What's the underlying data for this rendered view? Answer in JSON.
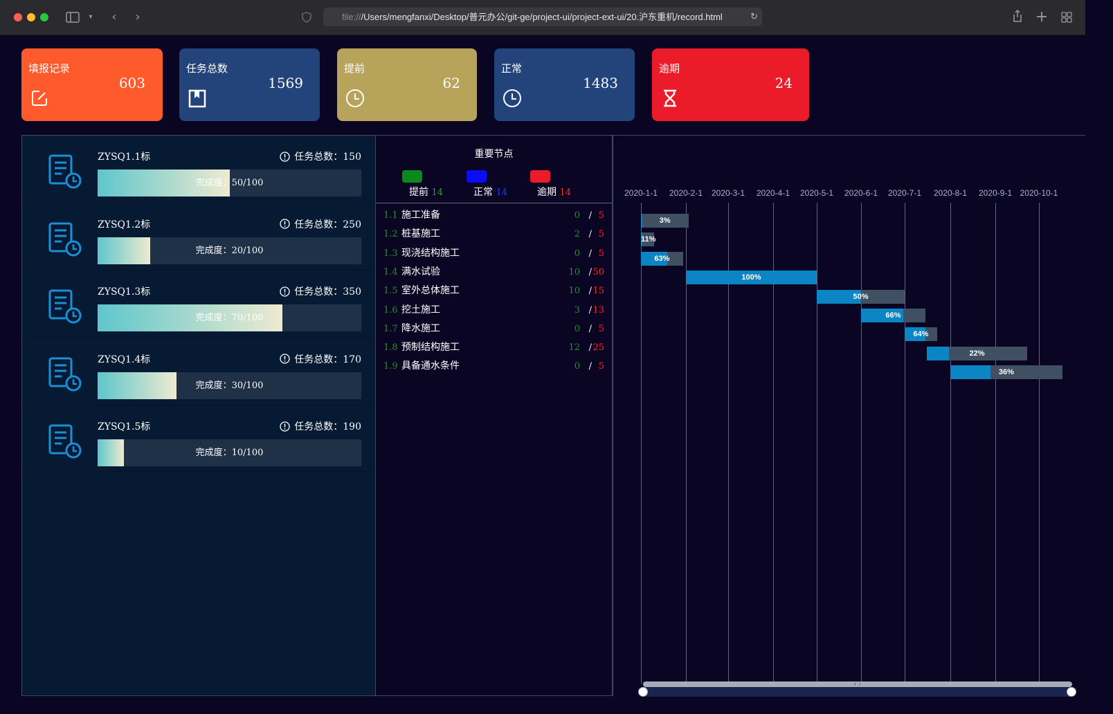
{
  "browser": {
    "url_prefix": "file://",
    "url_path": "/Users/mengfanxi/Desktop/普元办公/git-ge/project-ui/project-ext-ui/20.沪东重机/record.html"
  },
  "stats": [
    {
      "title": "填报记录",
      "value": "603",
      "color": "#ff5a2b",
      "icon": "edit-icon"
    },
    {
      "title": "任务总数",
      "value": "1569",
      "color": "#23447b",
      "icon": "bookmark-icon"
    },
    {
      "title": "提前",
      "value": "62",
      "color": "#b7a35a",
      "icon": "clock-icon"
    },
    {
      "title": "正常",
      "value": "1483",
      "color": "#23447b",
      "icon": "clock-icon"
    },
    {
      "title": "逾期",
      "value": "24",
      "color": "#ec1b2a",
      "icon": "hourglass-icon"
    }
  ],
  "sections": [
    {
      "name": "ZYSQ1.1标",
      "total_label": "任务总数：150",
      "progress_label": "完成度：50/100",
      "progress": 0.5
    },
    {
      "name": "ZYSQ1.2标",
      "total_label": "任务总数：250",
      "progress_label": "完成度：20/100",
      "progress": 0.2
    },
    {
      "name": "ZYSQ1.3标",
      "total_label": "任务总数：350",
      "progress_label": "完成度：70/100",
      "progress": 0.7
    },
    {
      "name": "ZYSQ1.4标",
      "total_label": "任务总数：170",
      "progress_label": "完成度：30/100",
      "progress": 0.3
    },
    {
      "name": "ZYSQ1.5标",
      "total_label": "任务总数：190",
      "progress_label": "完成度：10/100",
      "progress": 0.1
    }
  ],
  "nodes_panel": {
    "title": "重要节点",
    "legend": [
      {
        "label": "提前",
        "count": "14",
        "color": "#0b8a1b",
        "count_color": "#2aa52a"
      },
      {
        "label": "正常",
        "count": "14",
        "color": "#0b0bf5",
        "count_color": "#1a3cff"
      },
      {
        "label": "逾期",
        "count": "14",
        "color": "#ec1b2a",
        "count_color": "#ff2a2a"
      }
    ],
    "rows": [
      {
        "num": "1.1",
        "name": "施工准备",
        "ahead": "0",
        "over": "5"
      },
      {
        "num": "1.2",
        "name": "桩基施工",
        "ahead": "2",
        "over": "5"
      },
      {
        "num": "1.3",
        "name": "现浇结构施工",
        "ahead": "0",
        "over": "5"
      },
      {
        "num": "1.4",
        "name": "满水试验",
        "ahead": "10",
        "over": "50"
      },
      {
        "num": "1.5",
        "name": "室外总体施工",
        "ahead": "10",
        "over": "15"
      },
      {
        "num": "1.6",
        "name": "挖土施工",
        "ahead": "3",
        "over": "13"
      },
      {
        "num": "1.7",
        "name": "降水施工",
        "ahead": "0",
        "over": "5"
      },
      {
        "num": "1.8",
        "name": "预制结构施工",
        "ahead": "12",
        "over": "25"
      },
      {
        "num": "1.9",
        "name": "具备通水条件",
        "ahead": "0",
        "over": "5"
      }
    ],
    "slash": "/"
  },
  "chart_data": {
    "type": "gantt",
    "x_ticks": [
      "2020-1-1",
      "2020-2-1",
      "2020-3-1",
      "2020-4-1",
      "2020-5-1",
      "2020-6-1",
      "2020-7-1",
      "2020-8-1",
      "2020-9-1",
      "2020-10-1"
    ],
    "tasks": [
      {
        "label": "3%",
        "start": "2020-1-1",
        "end": "2020-2-3",
        "progress": 0.03
      },
      {
        "label": "11%",
        "start": "2020-1-1",
        "end": "2020-1-10",
        "progress": 0.11
      },
      {
        "label": "63%",
        "start": "2020-1-1",
        "end": "2020-1-30",
        "progress": 0.63
      },
      {
        "label": "100%",
        "start": "2020-2-1",
        "end": "2020-5-1",
        "progress": 1.0
      },
      {
        "label": "50%",
        "start": "2020-5-1",
        "end": "2020-7-1",
        "progress": 0.5
      },
      {
        "label": "66%",
        "start": "2020-6-1",
        "end": "2020-7-15",
        "progress": 0.66
      },
      {
        "label": "64%",
        "start": "2020-7-1",
        "end": "2020-7-23",
        "progress": 0.64
      },
      {
        "label": "22%",
        "start": "2020-7-16",
        "end": "2020-9-23",
        "progress": 0.22
      },
      {
        "label": "36%",
        "start": "2020-8-1",
        "end": "2020-10-22",
        "progress": 0.36
      }
    ]
  }
}
